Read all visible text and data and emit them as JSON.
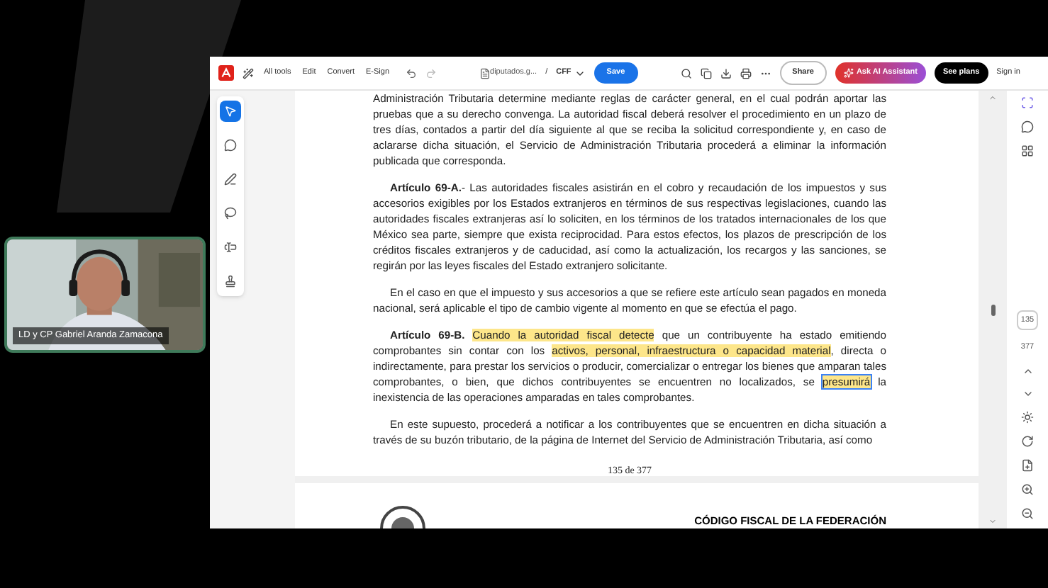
{
  "webcam": {
    "name": "LD y CP Gabriel Aranda Zamacona"
  },
  "toolbar": {
    "menu": [
      {
        "label": "All tools"
      },
      {
        "label": "Edit"
      },
      {
        "label": "Convert"
      },
      {
        "label": "E-Sign"
      }
    ],
    "file_name": "diputados.g...",
    "path_separator": "/",
    "document": "CFF",
    "save": "Save",
    "share": "Share",
    "ai_assistant": "Ask AI Assistant",
    "plans": "See plans",
    "sign_in": "Sign in"
  },
  "left_tools": [
    {
      "kind": "select",
      "selected": true
    },
    {
      "kind": "comment",
      "selected": false
    },
    {
      "kind": "draw",
      "selected": false
    },
    {
      "kind": "lasso",
      "selected": false
    },
    {
      "kind": "text",
      "selected": false
    },
    {
      "kind": "stamp",
      "selected": false
    }
  ],
  "document": {
    "paragraphs": [
      {
        "indent": false,
        "segments": [
          {
            "kind": "plain",
            "text": "Administración Tributaria determine mediante reglas de carácter general, en el cual podrán aportar las pruebas que a su derecho convenga. La autoridad fiscal deberá resolver el procedimiento en un plazo de tres días, contados a partir del día siguiente al que se reciba la solicitud correspondiente y, en caso de aclararse dicha situación, el Servicio de Administración Tributaria procederá a eliminar la información publicada que corresponda."
          }
        ]
      },
      {
        "indent": true,
        "segments": [
          {
            "kind": "bold",
            "text": "Artículo 69-A."
          },
          {
            "kind": "plain",
            "text": "- Las autoridades fiscales asistirán en el cobro y recaudación de los impuestos y sus accesorios exigibles por los Estados extranjeros en términos de sus respectivas legislaciones, cuando las autoridades fiscales extranjeras así lo soliciten, en los términos de los tratados internacionales de los que México sea parte, siempre que exista reciprocidad. Para estos efectos, los plazos de prescripción de los créditos fiscales extranjeros y de caducidad, así como la actualización, los recargos y las sanciones, se regirán por las leyes fiscales del Estado extranjero solicitante."
          }
        ]
      },
      {
        "indent": true,
        "segments": [
          {
            "kind": "plain",
            "text": "En el caso en que el impuesto y sus accesorios a que se refiere este artículo sean pagados en moneda nacional, será aplicable el tipo de cambio vigente al momento en que se efectúa el pago."
          }
        ]
      },
      {
        "indent": true,
        "segments": [
          {
            "kind": "bold",
            "text": "Artículo 69-B. "
          },
          {
            "kind": "highlight",
            "text": "Cuando la autoridad fiscal detecte"
          },
          {
            "kind": "plain",
            "text": " que un contribuyente ha estado emitiendo comprobantes sin contar con los "
          },
          {
            "kind": "highlight",
            "text": "activos, personal, infraestructura o capacidad material"
          },
          {
            "kind": "plain",
            "text": ", directa o indirectamente, para prestar los servicios o producir, comercializar o entregar los bienes que amparan tales comprobantes, o bien, que dichos contribuyentes se encuentren no localizados, se "
          },
          {
            "kind": "selected",
            "text": "presumirá"
          },
          {
            "kind": "plain",
            "text": " la inexistencia de las operaciones amparadas en tales comprobantes."
          }
        ]
      },
      {
        "indent": true,
        "segments": [
          {
            "kind": "plain",
            "text": "En este supuesto, procederá a notificar a los contribuyentes que se encuentren en dicha situación a través de su buzón tributario, de la página de Internet del Servicio de Administración Tributaria, así como"
          }
        ]
      }
    ],
    "page_label": "135 de 377",
    "next_page_header": "CÓDIGO FISCAL DE LA FEDERACIÓN"
  },
  "page_nav": {
    "current": "135",
    "total": "377"
  }
}
